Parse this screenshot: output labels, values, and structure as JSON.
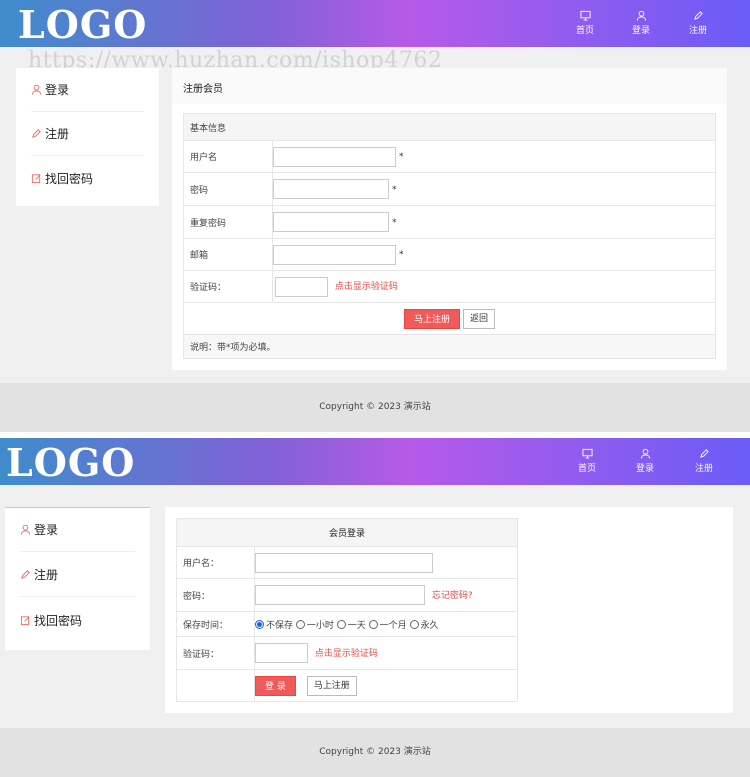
{
  "watermark": "https://www.huzhan.com/ishop4762",
  "logo": "LOGO",
  "nav": {
    "home": "首页",
    "login": "登录",
    "register": "注册"
  },
  "sidebar": {
    "items": [
      {
        "label": "登录"
      },
      {
        "label": "注册"
      },
      {
        "label": "找回密码"
      }
    ]
  },
  "register": {
    "title": "注册会员",
    "section": "基本信息",
    "fields": {
      "username": "用户名",
      "password": "密码",
      "repeat": "重复密码",
      "email": "邮箱",
      "captcha": "验证码："
    },
    "required_mark": "*",
    "captcha_link": "点击显示验证码",
    "submit": "马上注册",
    "back": "返回",
    "note": "说明：带*项为必填。"
  },
  "login": {
    "title": "会员登录",
    "fields": {
      "username": "用户名：",
      "password": "密码：",
      "keep": "保存时间：",
      "captcha": "验证码："
    },
    "forgot": "忘记密码?",
    "keep_options": [
      "不保存",
      "一小时",
      "一天",
      "一个月",
      "永久"
    ],
    "keep_selected": "不保存",
    "captcha_link": "点击显示验证码",
    "submit": "登 录",
    "register": "马上注册"
  },
  "footer": "Copyright © 2023 演示站",
  "colors": {
    "accent_red": "#ef5a5a",
    "header_start": "#3f8dcb",
    "header_mid": "#b65ae8",
    "header_end": "#6a5cf6"
  }
}
